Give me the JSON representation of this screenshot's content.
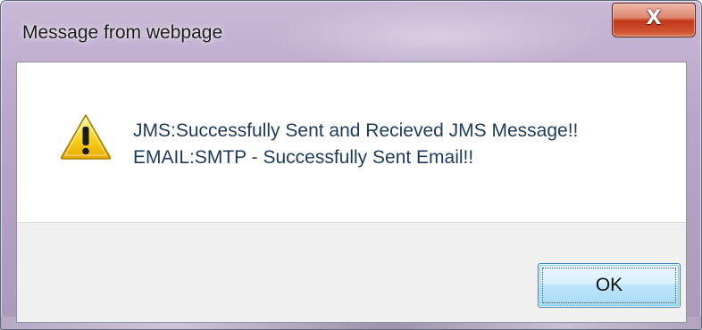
{
  "window": {
    "title": "Message from webpage",
    "close_icon": "close-icon",
    "close_glyph": "X"
  },
  "message": {
    "icon": "warning-icon",
    "lines": [
      "JMS:Successfully Sent and Recieved JMS Message!!",
      "EMAIL:SMTP - Successfully Sent Email!!"
    ]
  },
  "buttons": {
    "ok_label": "OK"
  },
  "colors": {
    "close_button": "#c2391a",
    "ok_button_border": "#3c7fb1",
    "message_text": "#1e3a5a",
    "warning_yellow": "#f5c400"
  }
}
